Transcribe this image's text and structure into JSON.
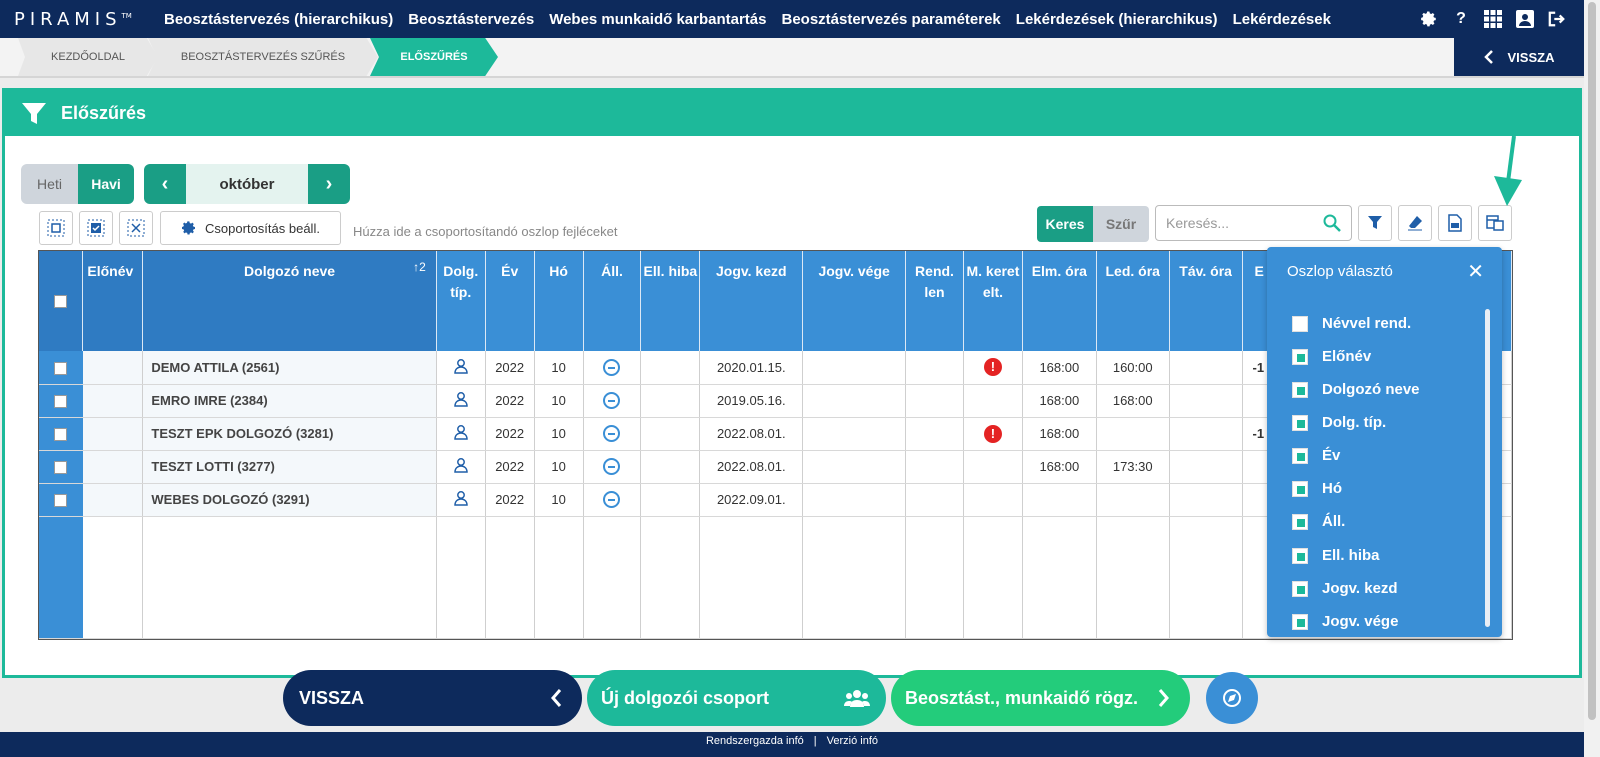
{
  "nav": {
    "logo": "PIRAMIS",
    "logo_tm": "TM",
    "links": [
      "Beosztástervezés (hierarchikus)",
      "Beosztástervezés",
      "Webes munkaidő karbantartás",
      "Beosztástervezés paraméterek",
      "Lekérdezések (hierarchikus)",
      "Lekérdezések"
    ]
  },
  "breadcrumb": {
    "items": [
      "KEZDŐOLDAL",
      "BEOSZTÁSTERVEZÉS SZŰRÉS",
      "ELŐSZŰRÉS"
    ],
    "back": "VISSZA"
  },
  "panel": {
    "title": "Előszűrés"
  },
  "period": {
    "heti": "Heti",
    "havi": "Havi",
    "month": "október"
  },
  "toolbar": {
    "group_button": "Csoportosítás beáll.",
    "group_hint": "Húzza ide a csoportosítandó oszlop fejléceket",
    "keres": "Keres",
    "szur": "Szűr",
    "search_placeholder": "Keresés..."
  },
  "table": {
    "headers": [
      "Előnév",
      "Dolgozó neve",
      "Dolg. típ.",
      "Év",
      "Hó",
      "Áll.",
      "Ell. hiba",
      "Jogv. kezd",
      "Jogv. vége",
      "Rend. len",
      "M. keret elt.",
      "Elm. óra",
      "Led. óra",
      "Táv. óra",
      "E"
    ],
    "sort_indicator": "↑2",
    "rows": [
      {
        "name": "DEMO ATTILA (2561)",
        "ev": "2022",
        "ho": "10",
        "jogv_kezd": "2020.01.15.",
        "warn": "!",
        "elm": "168:00",
        "led": "160:00",
        "extra": "-1"
      },
      {
        "name": "EMRO IMRE (2384)",
        "ev": "2022",
        "ho": "10",
        "jogv_kezd": "2019.05.16.",
        "warn": "",
        "elm": "168:00",
        "led": "168:00",
        "extra": ""
      },
      {
        "name": "TESZT EPK DOLGOZÓ (3281)",
        "ev": "2022",
        "ho": "10",
        "jogv_kezd": "2022.08.01.",
        "warn": "!",
        "elm": "168:00",
        "led": "",
        "extra": "-1"
      },
      {
        "name": "TESZT LOTTI (3277)",
        "ev": "2022",
        "ho": "10",
        "jogv_kezd": "2022.08.01.",
        "warn": "",
        "elm": "168:00",
        "led": "173:30",
        "extra": ""
      },
      {
        "name": "WEBES DOLGOZÓ (3291)",
        "ev": "2022",
        "ho": "10",
        "jogv_kezd": "2022.09.01.",
        "warn": "",
        "elm": "",
        "led": "",
        "extra": ""
      }
    ]
  },
  "chooser": {
    "title": "Oszlop választó",
    "items": [
      {
        "label": "Névvel rend.",
        "checked": false
      },
      {
        "label": "Előnév",
        "checked": true
      },
      {
        "label": "Dolgozó neve",
        "checked": true
      },
      {
        "label": "Dolg. típ.",
        "checked": true
      },
      {
        "label": "Év",
        "checked": true
      },
      {
        "label": "Hó",
        "checked": true
      },
      {
        "label": "Áll.",
        "checked": true
      },
      {
        "label": "Ell. hiba",
        "checked": true
      },
      {
        "label": "Jogv. kezd",
        "checked": true
      },
      {
        "label": "Jogv. vége",
        "checked": true
      }
    ]
  },
  "bottom": {
    "back": "VISSZA",
    "new_group": "Új dolgozói csoport",
    "record": "Beosztást., munkaidő rögz."
  },
  "footer": {
    "admin": "Rendszergazda infó",
    "sep": "|",
    "version": "Verzió infó"
  }
}
